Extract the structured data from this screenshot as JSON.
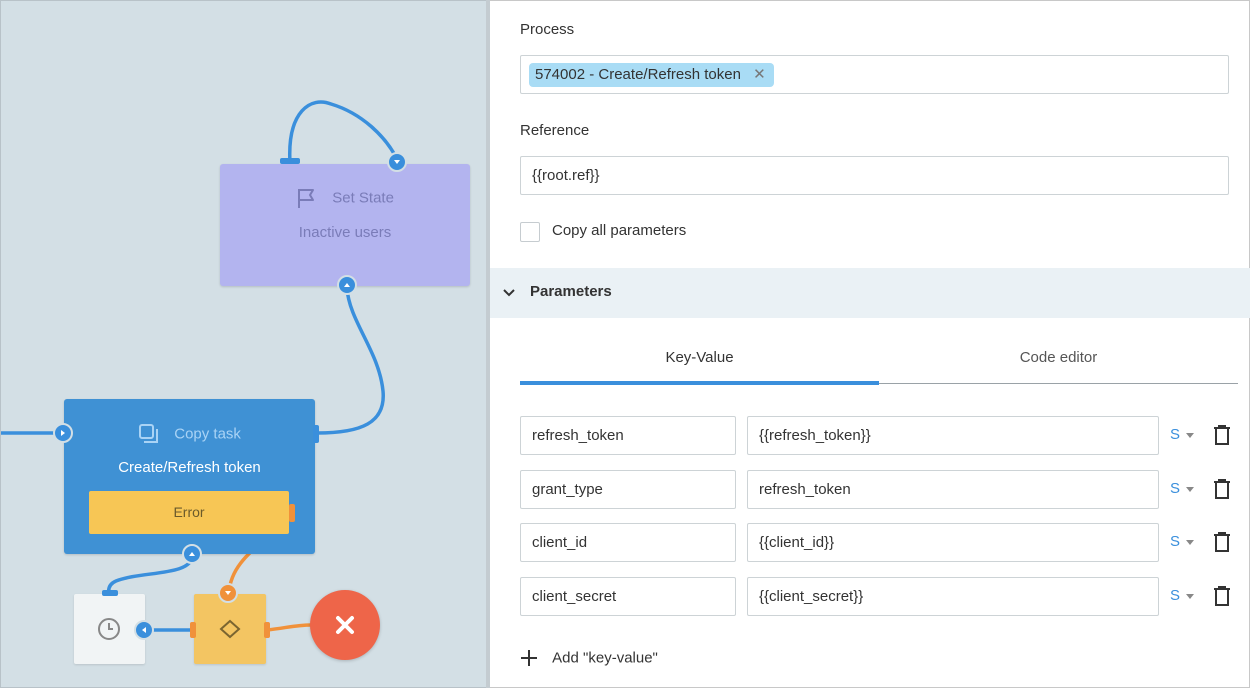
{
  "canvas": {
    "nodes": {
      "set_state": {
        "type_label": "Set State",
        "name": "Inactive users",
        "icon": "flag-icon",
        "color": "#b3b4ef"
      },
      "copy_task": {
        "type_label": "Copy task",
        "name": "Create/Refresh token",
        "icon": "copy-icon",
        "color": "#3f91d4",
        "error_label": "Error"
      },
      "timer": {
        "icon": "clock-icon",
        "color": "#f1f4f5"
      },
      "condition": {
        "icon": "diamond-icon",
        "color": "#f3c562"
      },
      "end": {
        "icon": "close-icon",
        "color": "#ee6549"
      }
    }
  },
  "panel": {
    "process": {
      "label": "Process",
      "chip": "574002 - Create/Refresh token",
      "chip_remove": "✕"
    },
    "reference": {
      "label": "Reference",
      "value": "{{root.ref}}"
    },
    "copy_all": {
      "label": "Copy all parameters",
      "checked": false
    },
    "parameters": {
      "title": "Parameters",
      "tabs": [
        {
          "label": "Key-Value",
          "active": true
        },
        {
          "label": "Code editor",
          "active": false
        }
      ],
      "rows": [
        {
          "key": "refresh_token",
          "value": "{{refresh_token}}",
          "type": "S"
        },
        {
          "key": "grant_type",
          "value": "refresh_token",
          "type": "S"
        },
        {
          "key": "client_id",
          "value": "{{client_id}}",
          "type": "S"
        },
        {
          "key": "client_secret",
          "value": "{{client_secret}}",
          "type": "S"
        }
      ],
      "add_label": "Add \"key-value\""
    }
  }
}
